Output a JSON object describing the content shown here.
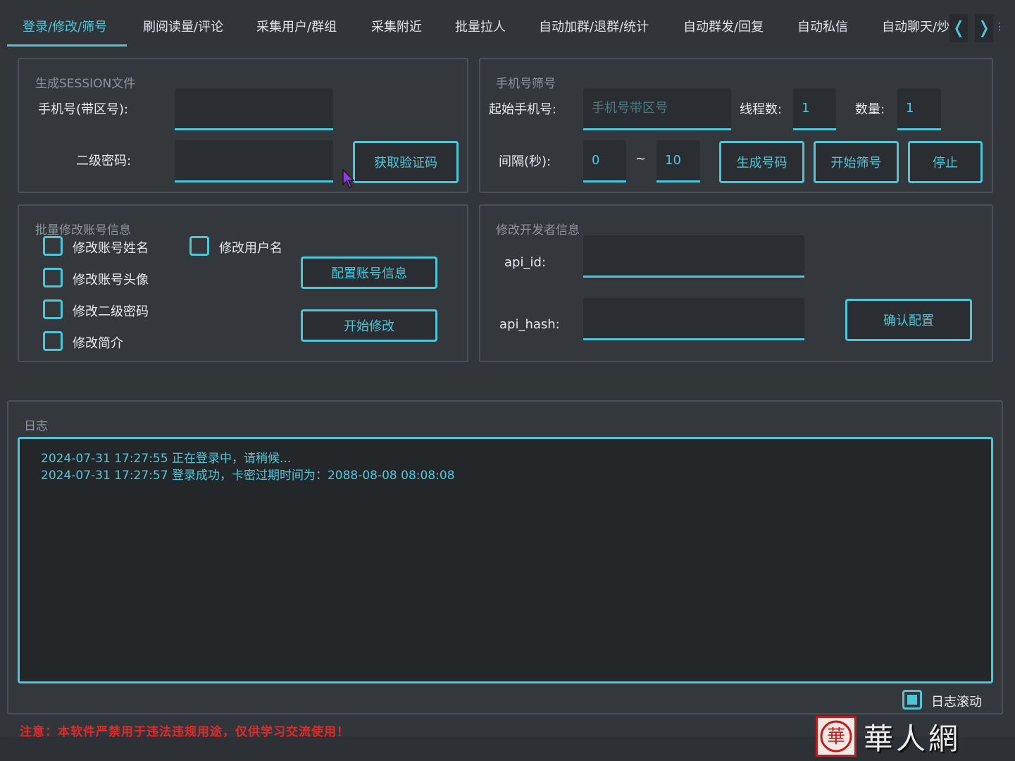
{
  "tabs": [
    {
      "label": "登录/修改/筛号",
      "active": true
    },
    {
      "label": "刷阅读量/评论"
    },
    {
      "label": "采集用户/群组"
    },
    {
      "label": "采集附近"
    },
    {
      "label": "批量拉人"
    },
    {
      "label": "自动加群/退群/统计"
    },
    {
      "label": "自动群发/回复"
    },
    {
      "label": "自动私信"
    },
    {
      "label": "自动聊天/炒"
    }
  ],
  "tab_nav": {
    "prev": "❬",
    "next": "❭"
  },
  "session": {
    "title": "生成SESSION文件",
    "phone_label": "手机号(带区号):",
    "phone_value": "",
    "password_label": "二级密码:",
    "password_value": "",
    "get_code_button": "获取验证码"
  },
  "filter": {
    "title": "手机号筛号",
    "start_label": "起始手机号:",
    "start_placeholder": "手机号带区号",
    "threads_label": "线程数:",
    "threads_value": "1",
    "count_label": "数量:",
    "count_value": "1",
    "interval_label": "间隔(秒):",
    "interval_from": "0",
    "interval_sep": "~",
    "interval_to": "10",
    "generate_button": "生成号码",
    "start_button": "开始筛号",
    "stop_button": "停止"
  },
  "batch": {
    "title": "批量修改账号信息",
    "options": [
      {
        "label": "修改账号姓名",
        "checked": false
      },
      {
        "label": "修改用户名",
        "checked": false
      },
      {
        "label": "修改账号头像",
        "checked": false
      },
      {
        "label": "修改二级密码",
        "checked": false
      },
      {
        "label": "修改简介",
        "checked": false
      }
    ],
    "config_button": "配置账号信息",
    "start_button": "开始修改"
  },
  "dev": {
    "title": "修改开发者信息",
    "api_id_label": "api_id:",
    "api_id_value": "",
    "api_hash_label": "api_hash:",
    "api_hash_value": "",
    "confirm_button": "确认配置"
  },
  "log": {
    "title": "日志",
    "lines": [
      "2024-07-31 17:27:55 正在登录中，请稍候...",
      "2024-07-31 17:27:57 登录成功，卡密过期时间为：2088-08-08 08:08:08"
    ],
    "scroll_label": "日志滚动",
    "scroll_checked": true
  },
  "footer": {
    "warning": "注意：本软件严禁用于违法违规用途，仅供学习交流使用！"
  },
  "watermark": {
    "seal": "華",
    "text": "華人網"
  },
  "colors": {
    "accent": "#4fc6d8",
    "background": "#32363b",
    "panel": "#34383d",
    "input": "#2a2d31",
    "warning": "#e02a2a"
  }
}
